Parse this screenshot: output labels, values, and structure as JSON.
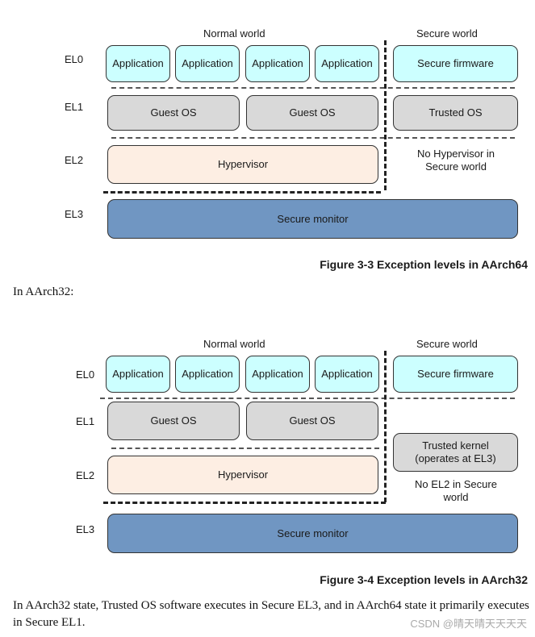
{
  "figure1": {
    "normal_world": "Normal world",
    "secure_world": "Secure world",
    "levels": [
      "EL0",
      "EL1",
      "EL2",
      "EL3"
    ],
    "applications": [
      "Application",
      "Application",
      "Application",
      "Application"
    ],
    "secure_firmware": "Secure firmware",
    "guest_os": [
      "Guest OS",
      "Guest OS"
    ],
    "trusted_os": "Trusted OS",
    "hypervisor": "Hypervisor",
    "no_hypervisor_note": "No Hypervisor in Secure world",
    "secure_monitor": "Secure monitor",
    "caption": "Figure 3-3 Exception levels in AArch64"
  },
  "intro_text": "In AArch32:",
  "figure2": {
    "normal_world": "Normal world",
    "secure_world": "Secure world",
    "levels": [
      "EL0",
      "EL1",
      "EL2",
      "EL3"
    ],
    "applications": [
      "Application",
      "Application",
      "Application",
      "Application"
    ],
    "secure_firmware": "Secure firmware",
    "guest_os": [
      "Guest OS",
      "Guest OS"
    ],
    "trusted_kernel": "Trusted kernel (operates at EL3)",
    "hypervisor": "Hypervisor",
    "no_el2_note": "No EL2 in Secure world",
    "secure_monitor": "Secure monitor",
    "caption": "Figure 3-4 Exception levels in AArch32"
  },
  "body_text": "In AArch32 state, Trusted OS software executes in Secure EL3, and in AArch64 state it primarily executes in Secure EL1.",
  "watermark": "CSDN @晴天晴天天天天"
}
